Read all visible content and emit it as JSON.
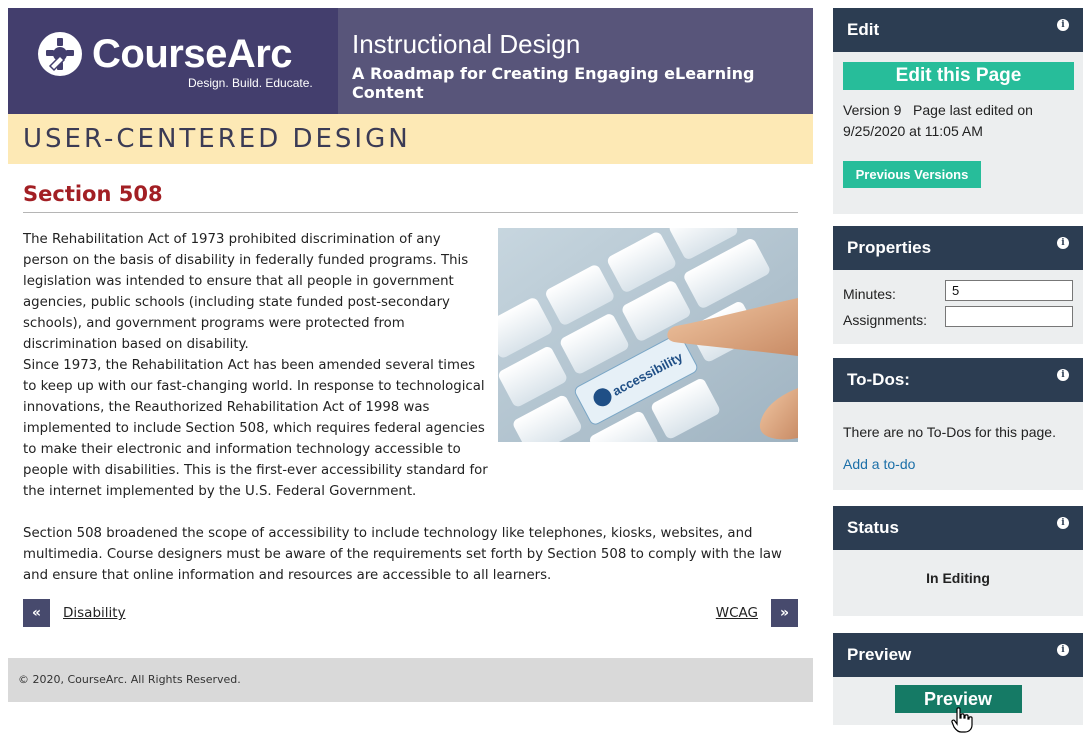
{
  "header": {
    "brand": "CourseArc",
    "tagline": "Design. Build. Educate.",
    "course_title": "Instructional Design",
    "course_subtitle": "A Roadmap for Creating Engaging eLearning Content",
    "logo_icon": "gear-hand-icon",
    "colors": {
      "logo_bg": "#433e6d",
      "title_bg": "#58557a"
    }
  },
  "module": {
    "title": "USER-CENTERED DESIGN",
    "color_bg": "#fde9b5"
  },
  "section": {
    "title": "Section 508",
    "title_color": "#a21f24",
    "paragraphs": [
      "The Rehabilitation Act of 1973 prohibited discrimination of any person on the basis of disability in federally funded programs. This legislation was intended to ensure that all people in government agencies, public schools (including state funded post-secondary schools), and government programs were protected from discrimination based on disability.",
      "Since 1973, the Rehabilitation Act has been amended several times to keep up with our fast-changing world. In response to technological innovations, the Reauthorized Rehabilitation Act of 1998 was implemented to include Section 508, which requires federal agencies to make their electronic and information technology accessible to people with disabilities. This is the first-ever accessibility standard for the internet implemented by the U.S. Federal Government.",
      "Section 508 broadened the scope of accessibility to include technology like telephones, kiosks, websites, and multimedia. Course designers must be aware of the requirements set forth by Section 508 to comply with the law and ensure that online information and resources are accessible to all learners."
    ],
    "image_key_label": "accessibility",
    "image_key_icon": "wheelchair-icon"
  },
  "pager": {
    "prev_symbol": "«",
    "prev_label": "Disability",
    "next_symbol": "»",
    "next_label": "WCAG"
  },
  "footer": {
    "copyright": "© 2020, CourseArc. All Rights Reserved."
  },
  "sidebar": {
    "edit": {
      "title": "Edit",
      "edit_button": "Edit this Page",
      "version_line": "Version 9   Page last edited on 9/25/2020 at 11:05 AM",
      "previous_versions_button": "Previous Versions"
    },
    "properties": {
      "title": "Properties",
      "minutes_label": "Minutes:",
      "minutes_value": "5",
      "assignments_label": "Assignments:",
      "assignments_value": ""
    },
    "todos": {
      "title": "To-Dos:",
      "empty_text": "There are no To-Dos for this page.",
      "add_link": "Add a to-do"
    },
    "status": {
      "title": "Status",
      "value": "In Editing"
    },
    "preview": {
      "title": "Preview",
      "button": "Preview"
    },
    "info_glyph": "i",
    "colors": {
      "panel_head": "#2c3d52",
      "teal": "#27bd9a",
      "dark_teal": "#157a65",
      "link": "#1b6fa8"
    }
  }
}
